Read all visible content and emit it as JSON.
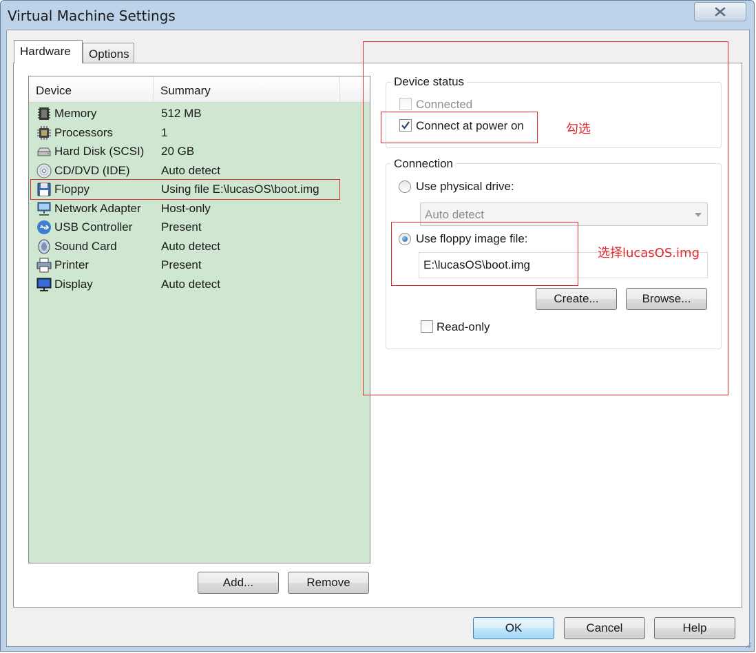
{
  "window": {
    "title": "Virtual Machine Settings"
  },
  "tabs": [
    {
      "label": "Hardware"
    },
    {
      "label": "Options"
    }
  ],
  "device_list": {
    "columns": [
      "Device",
      "Summary"
    ],
    "rows": [
      {
        "device": "Memory",
        "summary": "512 MB",
        "icon": "memory-chip-icon"
      },
      {
        "device": "Processors",
        "summary": "1",
        "icon": "processor-icon"
      },
      {
        "device": "Hard Disk (SCSI)",
        "summary": "20 GB",
        "icon": "hard-disk-icon"
      },
      {
        "device": "CD/DVD (IDE)",
        "summary": "Auto detect",
        "icon": "cd-dvd-icon"
      },
      {
        "device": "Floppy",
        "summary": "Using file E:\\lucasOS\\boot.img",
        "icon": "floppy-icon"
      },
      {
        "device": "Network Adapter",
        "summary": "Host-only",
        "icon": "network-adapter-icon"
      },
      {
        "device": "USB Controller",
        "summary": "Present",
        "icon": "usb-icon"
      },
      {
        "device": "Sound Card",
        "summary": "Auto detect",
        "icon": "speaker-icon"
      },
      {
        "device": "Printer",
        "summary": "Present",
        "icon": "printer-icon"
      },
      {
        "device": "Display",
        "summary": "Auto detect",
        "icon": "monitor-icon"
      }
    ],
    "selected": "Floppy"
  },
  "list_buttons": {
    "add": "Add...",
    "remove": "Remove"
  },
  "device_status": {
    "title": "Device status",
    "connected": {
      "label": "Connected",
      "checked": false,
      "enabled": false
    },
    "connect_at_power_on": {
      "label": "Connect at power on",
      "checked": true
    }
  },
  "connection": {
    "title": "Connection",
    "physical": {
      "label": "Use physical drive:",
      "selected": false
    },
    "physical_select": {
      "value": "Auto detect",
      "enabled": false
    },
    "image": {
      "label": "Use floppy image file:",
      "selected": true
    },
    "image_path": "E:\\lucasOS\\boot.img",
    "create_button": "Create...",
    "browse_button": "Browse...",
    "readonly": {
      "label": "Read-only",
      "checked": false
    }
  },
  "dialog_buttons": {
    "ok": "OK",
    "cancel": "Cancel",
    "help": "Help"
  },
  "annotations": {
    "check_note": "勾选",
    "select_note": "选择lucasOS.img",
    "color": "#e0282e"
  },
  "colors": {
    "list_bg": "#cfe6d0",
    "frame": "#bcd3ea"
  }
}
